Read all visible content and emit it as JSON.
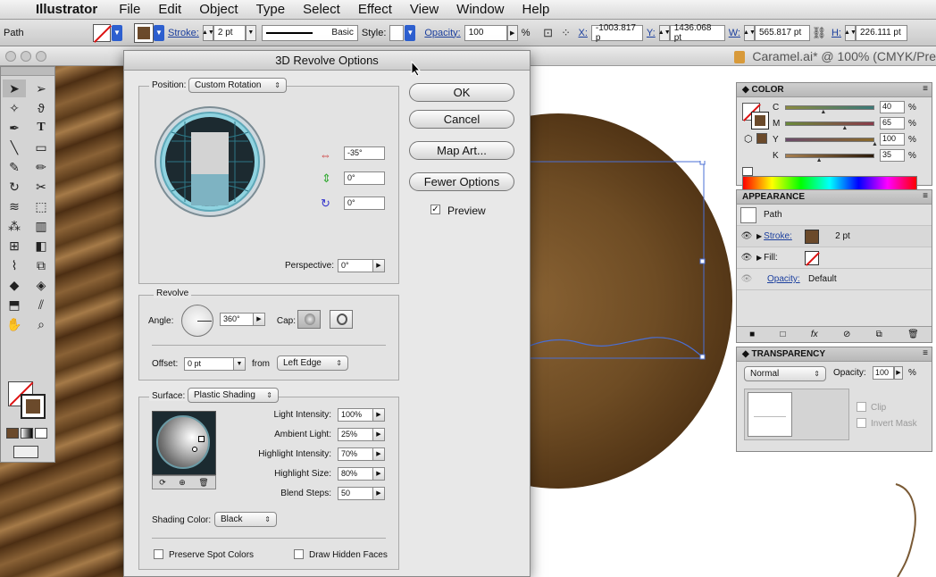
{
  "menubar": {
    "app": "Illustrator",
    "items": [
      "File",
      "Edit",
      "Object",
      "Type",
      "Select",
      "Effect",
      "View",
      "Window",
      "Help"
    ]
  },
  "control_bar": {
    "object_type": "Path",
    "stroke_label": "Stroke:",
    "stroke_weight": "2 pt",
    "brush": "Basic",
    "style_label": "Style:",
    "opacity_label": "Opacity:",
    "opacity_value": "100",
    "opacity_unit": "%",
    "x_label": "X:",
    "x_value": "-1003.817 p",
    "y_label": "Y:",
    "y_value": "1436.068 pt",
    "w_label": "W:",
    "w_value": "565.817 pt",
    "h_label": "H:",
    "h_value": "226.111 pt"
  },
  "document": {
    "title": "Caramel.ai* @ 100% (CMYK/Pre"
  },
  "dialog": {
    "title": "3D Revolve Options",
    "position_label": "Position:",
    "position_value": "Custom Rotation",
    "rot_x": "-35°",
    "rot_y": "0°",
    "rot_z": "0°",
    "perspective_label": "Perspective:",
    "perspective_value": "0°",
    "revolve_label": "Revolve",
    "angle_label": "Angle:",
    "angle_value": "360°",
    "cap_label": "Cap:",
    "offset_label": "Offset:",
    "offset_value": "0 pt",
    "from_label": "from",
    "from_value": "Left Edge",
    "surface_label": "Surface:",
    "surface_value": "Plastic Shading",
    "light_intensity_label": "Light Intensity:",
    "light_intensity": "100%",
    "ambient_light_label": "Ambient Light:",
    "ambient_light": "25%",
    "highlight_intensity_label": "Highlight Intensity:",
    "highlight_intensity": "70%",
    "highlight_size_label": "Highlight Size:",
    "highlight_size": "80%",
    "blend_steps_label": "Blend Steps:",
    "blend_steps": "50",
    "shading_color_label": "Shading Color:",
    "shading_color": "Black",
    "preserve_spot": "Preserve Spot Colors",
    "draw_hidden": "Draw Hidden Faces",
    "ok": "OK",
    "cancel": "Cancel",
    "map_art": "Map Art...",
    "fewer_options": "Fewer Options",
    "preview": "Preview",
    "preview_checked": true
  },
  "color_panel": {
    "title": "COLOR",
    "channels": [
      {
        "name": "C",
        "value": "40",
        "unit": "%",
        "level": 0.4
      },
      {
        "name": "M",
        "value": "65",
        "unit": "%",
        "level": 0.65
      },
      {
        "name": "Y",
        "value": "100",
        "unit": "%",
        "level": 1.0
      },
      {
        "name": "K",
        "value": "35",
        "unit": "%",
        "level": 0.35
      }
    ],
    "fill_color": "#6b4a2b"
  },
  "appearance_panel": {
    "title": "APPEARANCE",
    "object": "Path",
    "stroke_label": "Stroke:",
    "stroke_value": "2 pt",
    "fill_label": "Fill:",
    "opacity_label": "Opacity:",
    "opacity_value": "Default"
  },
  "transparency_panel": {
    "title": "TRANSPARENCY",
    "blend_mode": "Normal",
    "opacity_label": "Opacity:",
    "opacity_value": "100",
    "opacity_unit": "%",
    "clip": "Clip",
    "invert_mask": "Invert Mask"
  }
}
